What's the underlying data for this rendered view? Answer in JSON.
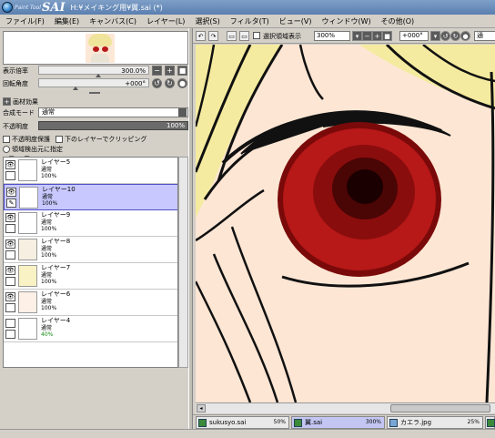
{
  "window": {
    "logo_small": "Paint Tool",
    "logo_big": "SAI",
    "title": "H:¥メイキング用¥翼.sai (*)"
  },
  "menu": [
    "ファイル(F)",
    "編集(E)",
    "キャンバス(C)",
    "レイヤー(L)",
    "選択(S)",
    "フィルタ(T)",
    "ビュー(V)",
    "ウィンドウ(W)",
    "その他(O)"
  ],
  "navigator": {
    "zoom_label": "表示倍率",
    "zoom_value": "300.0%",
    "rotation_label": "回転角度",
    "rotation_value": "+000°"
  },
  "layer_props": {
    "paper_effect": "画材効果",
    "blend_label": "合成モード",
    "blend_value": "通常",
    "opacity_label": "不透明度",
    "opacity_value": "100%",
    "protect_opacity": "不透明度保護",
    "clip_lower": "下のレイヤーでクリッピング",
    "selection_source": "領域検出元に指定"
  },
  "layers": [
    {
      "name": "レイヤー5",
      "mode": "通常",
      "opacity": "100%",
      "visible": true,
      "selected": false,
      "green": false
    },
    {
      "name": "レイヤー10",
      "mode": "通常",
      "opacity": "100%",
      "visible": true,
      "selected": true,
      "green": false
    },
    {
      "name": "レイヤー9",
      "mode": "通常",
      "opacity": "100%",
      "visible": true,
      "selected": false,
      "green": false
    },
    {
      "name": "レイヤー8",
      "mode": "通常",
      "opacity": "100%",
      "visible": true,
      "selected": false,
      "green": false
    },
    {
      "name": "レイヤー7",
      "mode": "通常",
      "opacity": "100%",
      "visible": true,
      "selected": false,
      "green": false
    },
    {
      "name": "レイヤー6",
      "mode": "通常",
      "opacity": "100%",
      "visible": true,
      "selected": false,
      "green": false
    },
    {
      "name": "レイヤー4",
      "mode": "通常",
      "opacity": "40%",
      "visible": false,
      "selected": false,
      "green": true
    }
  ],
  "canvas_toolbar": {
    "show_selection": "選択領域表示",
    "zoom": "300%",
    "rotation": "+000°",
    "trailing": "通"
  },
  "tabs": [
    {
      "name": "sukusyo.sai",
      "zoom": "50%",
      "active": false
    },
    {
      "name": "翼.sai",
      "zoom": "300%",
      "active": true
    },
    {
      "name": "カエラ.jpg",
      "zoom": "25%",
      "active": false
    }
  ],
  "colors": {
    "skin": "#fde6d4",
    "hair": "#f5eba0",
    "iris": "#b71818",
    "line": "#000000",
    "selected_layer": "#c8c8ff"
  }
}
